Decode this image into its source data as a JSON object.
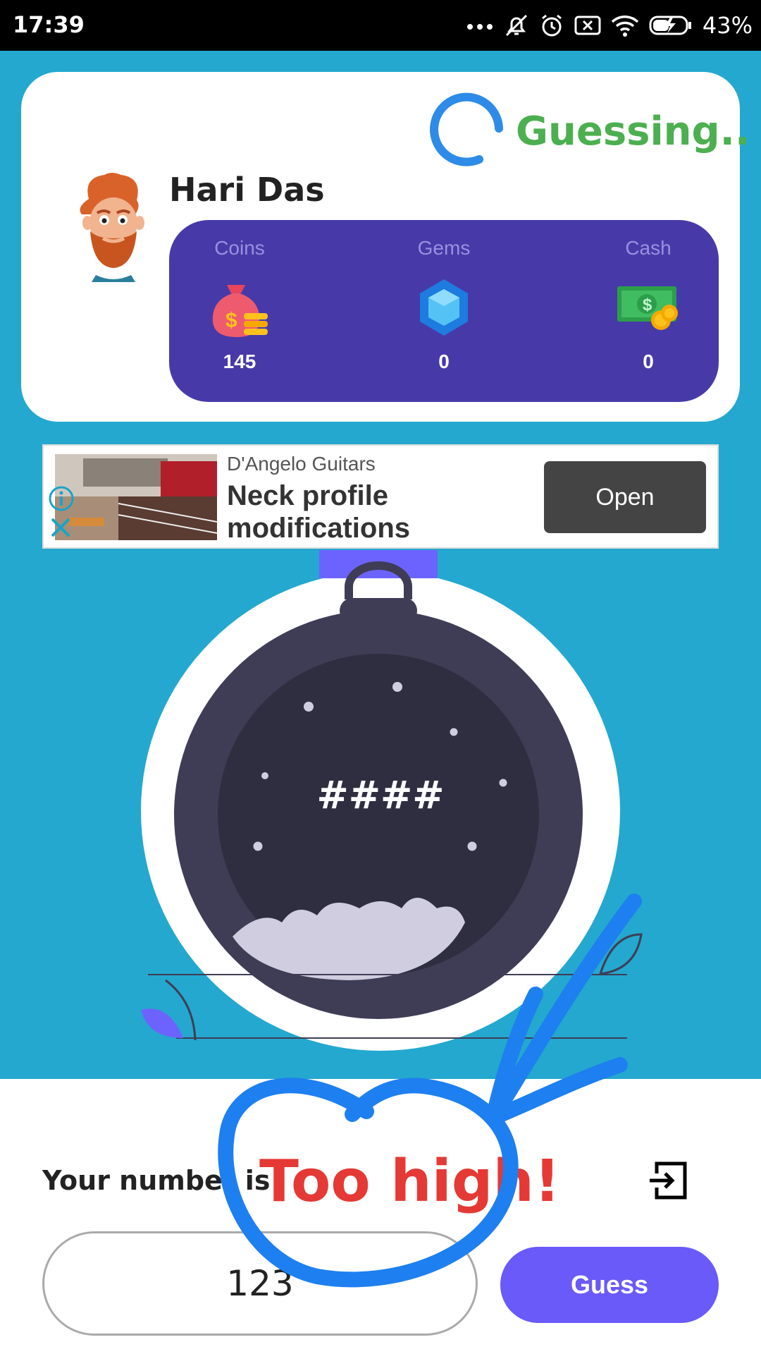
{
  "status_bar": {
    "time": "17:39",
    "battery": "43%"
  },
  "profile": {
    "status": "Guessing..",
    "name": "Hari Das",
    "wallet": [
      {
        "label": "Coins",
        "value": "145",
        "icon": "money-bag-icon"
      },
      {
        "label": "Gems",
        "value": "0",
        "icon": "gem-icon"
      },
      {
        "label": "Cash",
        "value": "0",
        "icon": "cash-icon"
      }
    ]
  },
  "ad": {
    "advertiser": "D'Angelo Guitars",
    "headline": "Neck profile modifications",
    "cta": "Open"
  },
  "game": {
    "secret": "####",
    "prompt": "Your number is",
    "result": "Too high!",
    "guess_value": "123",
    "guess_button": "Guess"
  },
  "colors": {
    "background": "#24a8cf",
    "wallet": "#473aa8",
    "status": "#4caf50",
    "result": "#e53935",
    "button": "#6a5af9",
    "annotation": "#1e7ff0"
  }
}
